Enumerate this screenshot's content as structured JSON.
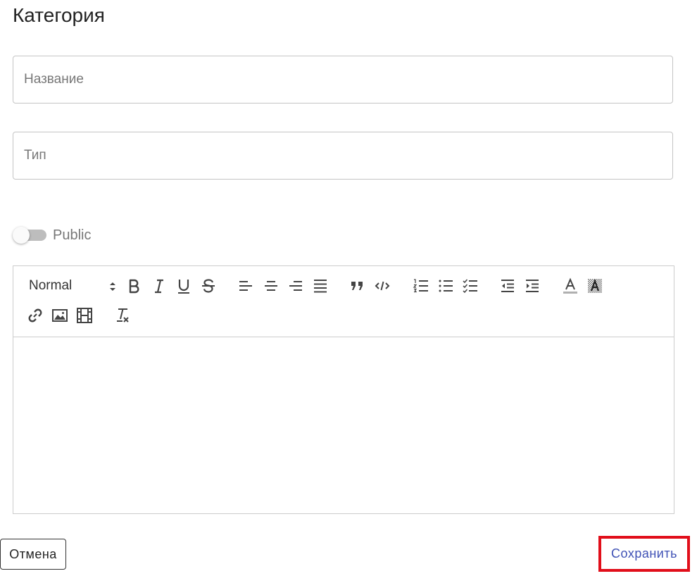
{
  "form": {
    "title": "Категория",
    "name_placeholder": "Название",
    "name_value": "",
    "type_placeholder": "Тип",
    "type_value": "",
    "public_label": "Public",
    "public_checked": false
  },
  "editor": {
    "header_value": "Normal",
    "content": "",
    "tools": [
      "bold-icon",
      "italic-icon",
      "underline-icon",
      "strike-icon",
      "align-left-icon",
      "align-center-icon",
      "align-right-icon",
      "align-justify-icon",
      "blockquote-icon",
      "code-icon",
      "ordered-list-icon",
      "bullet-list-icon",
      "check-list-icon",
      "outdent-icon",
      "indent-icon",
      "text-color-icon",
      "background-color-icon",
      "link-icon",
      "image-icon",
      "video-icon",
      "clear-format-icon"
    ]
  },
  "actions": {
    "cancel_label": "Отмена",
    "save_label": "Сохранить"
  },
  "colors": {
    "primary": "#3f51b5",
    "highlight": "#e10e1a",
    "border": "#c4c4c4"
  }
}
